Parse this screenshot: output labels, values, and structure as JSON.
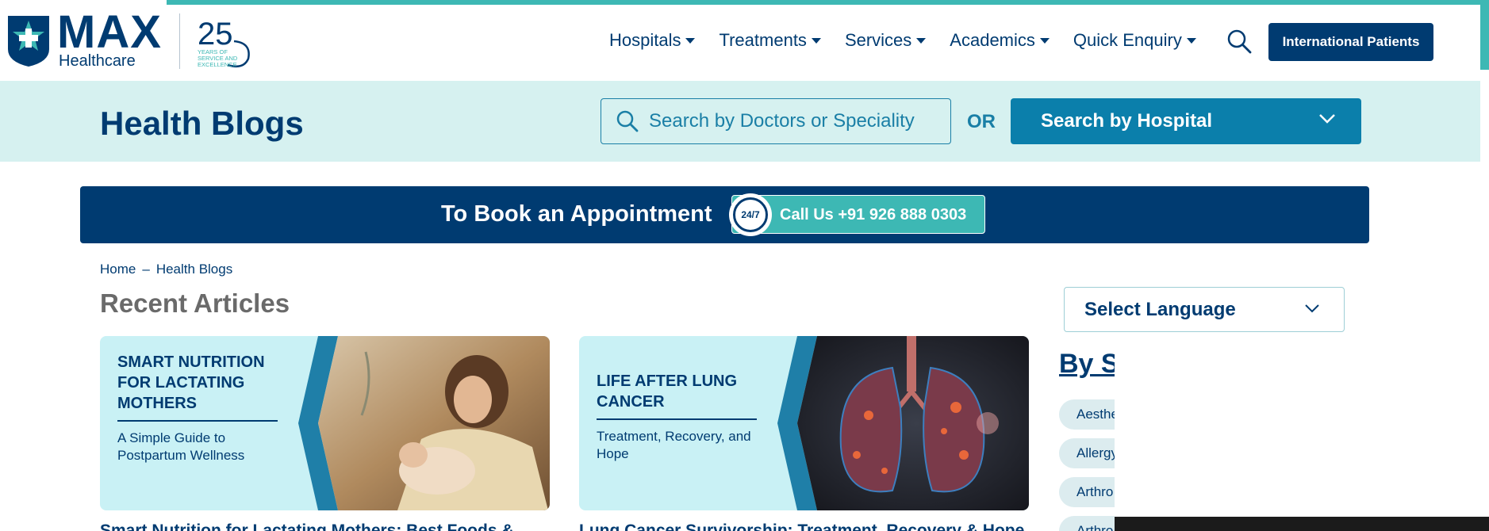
{
  "header": {
    "brand_name": "MAX",
    "brand_sub": "Healthcare",
    "anniversary_number": "25",
    "anniversary_text": [
      "YEARS OF",
      "SERVICE AND",
      "EXCELLENCE"
    ],
    "nav": [
      "Hospitals",
      "Treatments",
      "Services",
      "Academics",
      "Quick Enquiry"
    ],
    "intl_button": "International Patients"
  },
  "blog_bar": {
    "title": "Health Blogs",
    "search_placeholder": "Search by Doctors or Speciality",
    "or_text": "OR",
    "hospital_select": "Search by Hospital"
  },
  "appointment": {
    "text": "To Book an Appointment",
    "badge": "24/7",
    "call_label": "Call Us  +91 926 888 0303"
  },
  "breadcrumb": {
    "home": "Home",
    "separator": "–",
    "current": "Health Blogs"
  },
  "recent": {
    "heading": "Recent Articles",
    "cards": [
      {
        "title": "SMART NUTRITION FOR LACTATING MOTHERS",
        "subtitle": "A Simple Guide to Postpartum Wellness",
        "heading": "Smart Nutrition for Lactating Mothers: Best Foods &"
      },
      {
        "title": "LIFE AFTER LUNG CANCER",
        "subtitle": "Treatment, Recovery, and Hope",
        "heading": "Lung Cancer Survivorship: Treatment, Recovery & Hope"
      }
    ]
  },
  "sidebar": {
    "language_select": "Select Language",
    "by_speciality": "By S",
    "chips": [
      "Aesthe",
      "Allergy",
      "Arthro",
      "Arthro"
    ]
  },
  "colors": {
    "navy": "#003b71",
    "teal": "#3db8b4",
    "blue": "#0b7fab",
    "light_teal": "#d6f1f0"
  }
}
